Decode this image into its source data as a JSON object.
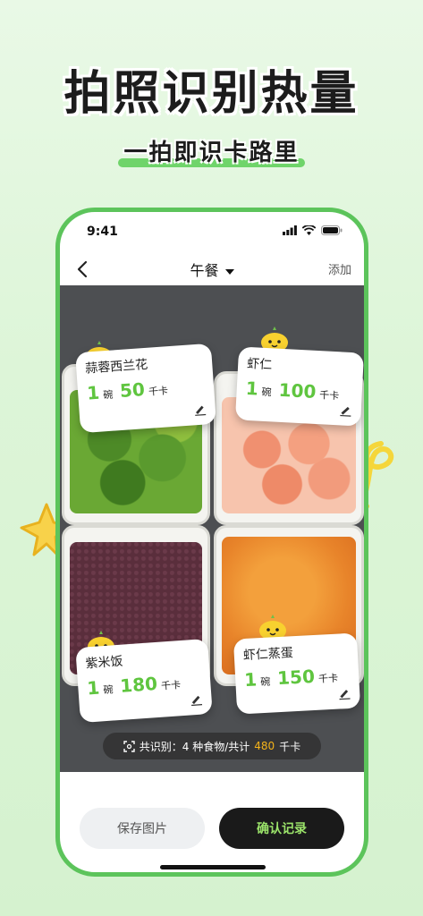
{
  "promo": {
    "headline": "拍照识别热量",
    "subline": "一拍即识卡路里"
  },
  "status": {
    "time": "9:41"
  },
  "nav": {
    "back_icon": "chevron-left-icon",
    "title": "午餐",
    "title_icon": "caret-down-icon",
    "add_label": "添加"
  },
  "foods": [
    {
      "name": "蒜蓉西兰花",
      "qty": "1",
      "unit": "碗",
      "kcal": "50",
      "kcal_unit": "千卡"
    },
    {
      "name": "虾仁",
      "qty": "1",
      "unit": "碗",
      "kcal": "100",
      "kcal_unit": "千卡"
    },
    {
      "name": "紫米饭",
      "qty": "1",
      "unit": "碗",
      "kcal": "180",
      "kcal_unit": "千卡"
    },
    {
      "name": "虾仁蒸蛋",
      "qty": "1",
      "unit": "碗",
      "kcal": "150",
      "kcal_unit": "千卡"
    }
  ],
  "summary": {
    "prefix": "共识别：4 种食物/共计",
    "total": "480",
    "suffix": "千卡"
  },
  "actions": {
    "save_label": "保存图片",
    "confirm_label": "确认记录"
  },
  "colors": {
    "accent_green": "#5fc53f",
    "frame_green": "#5cc45b",
    "highlight_orange": "#f3b21a",
    "confirm_text": "#9be36a"
  }
}
